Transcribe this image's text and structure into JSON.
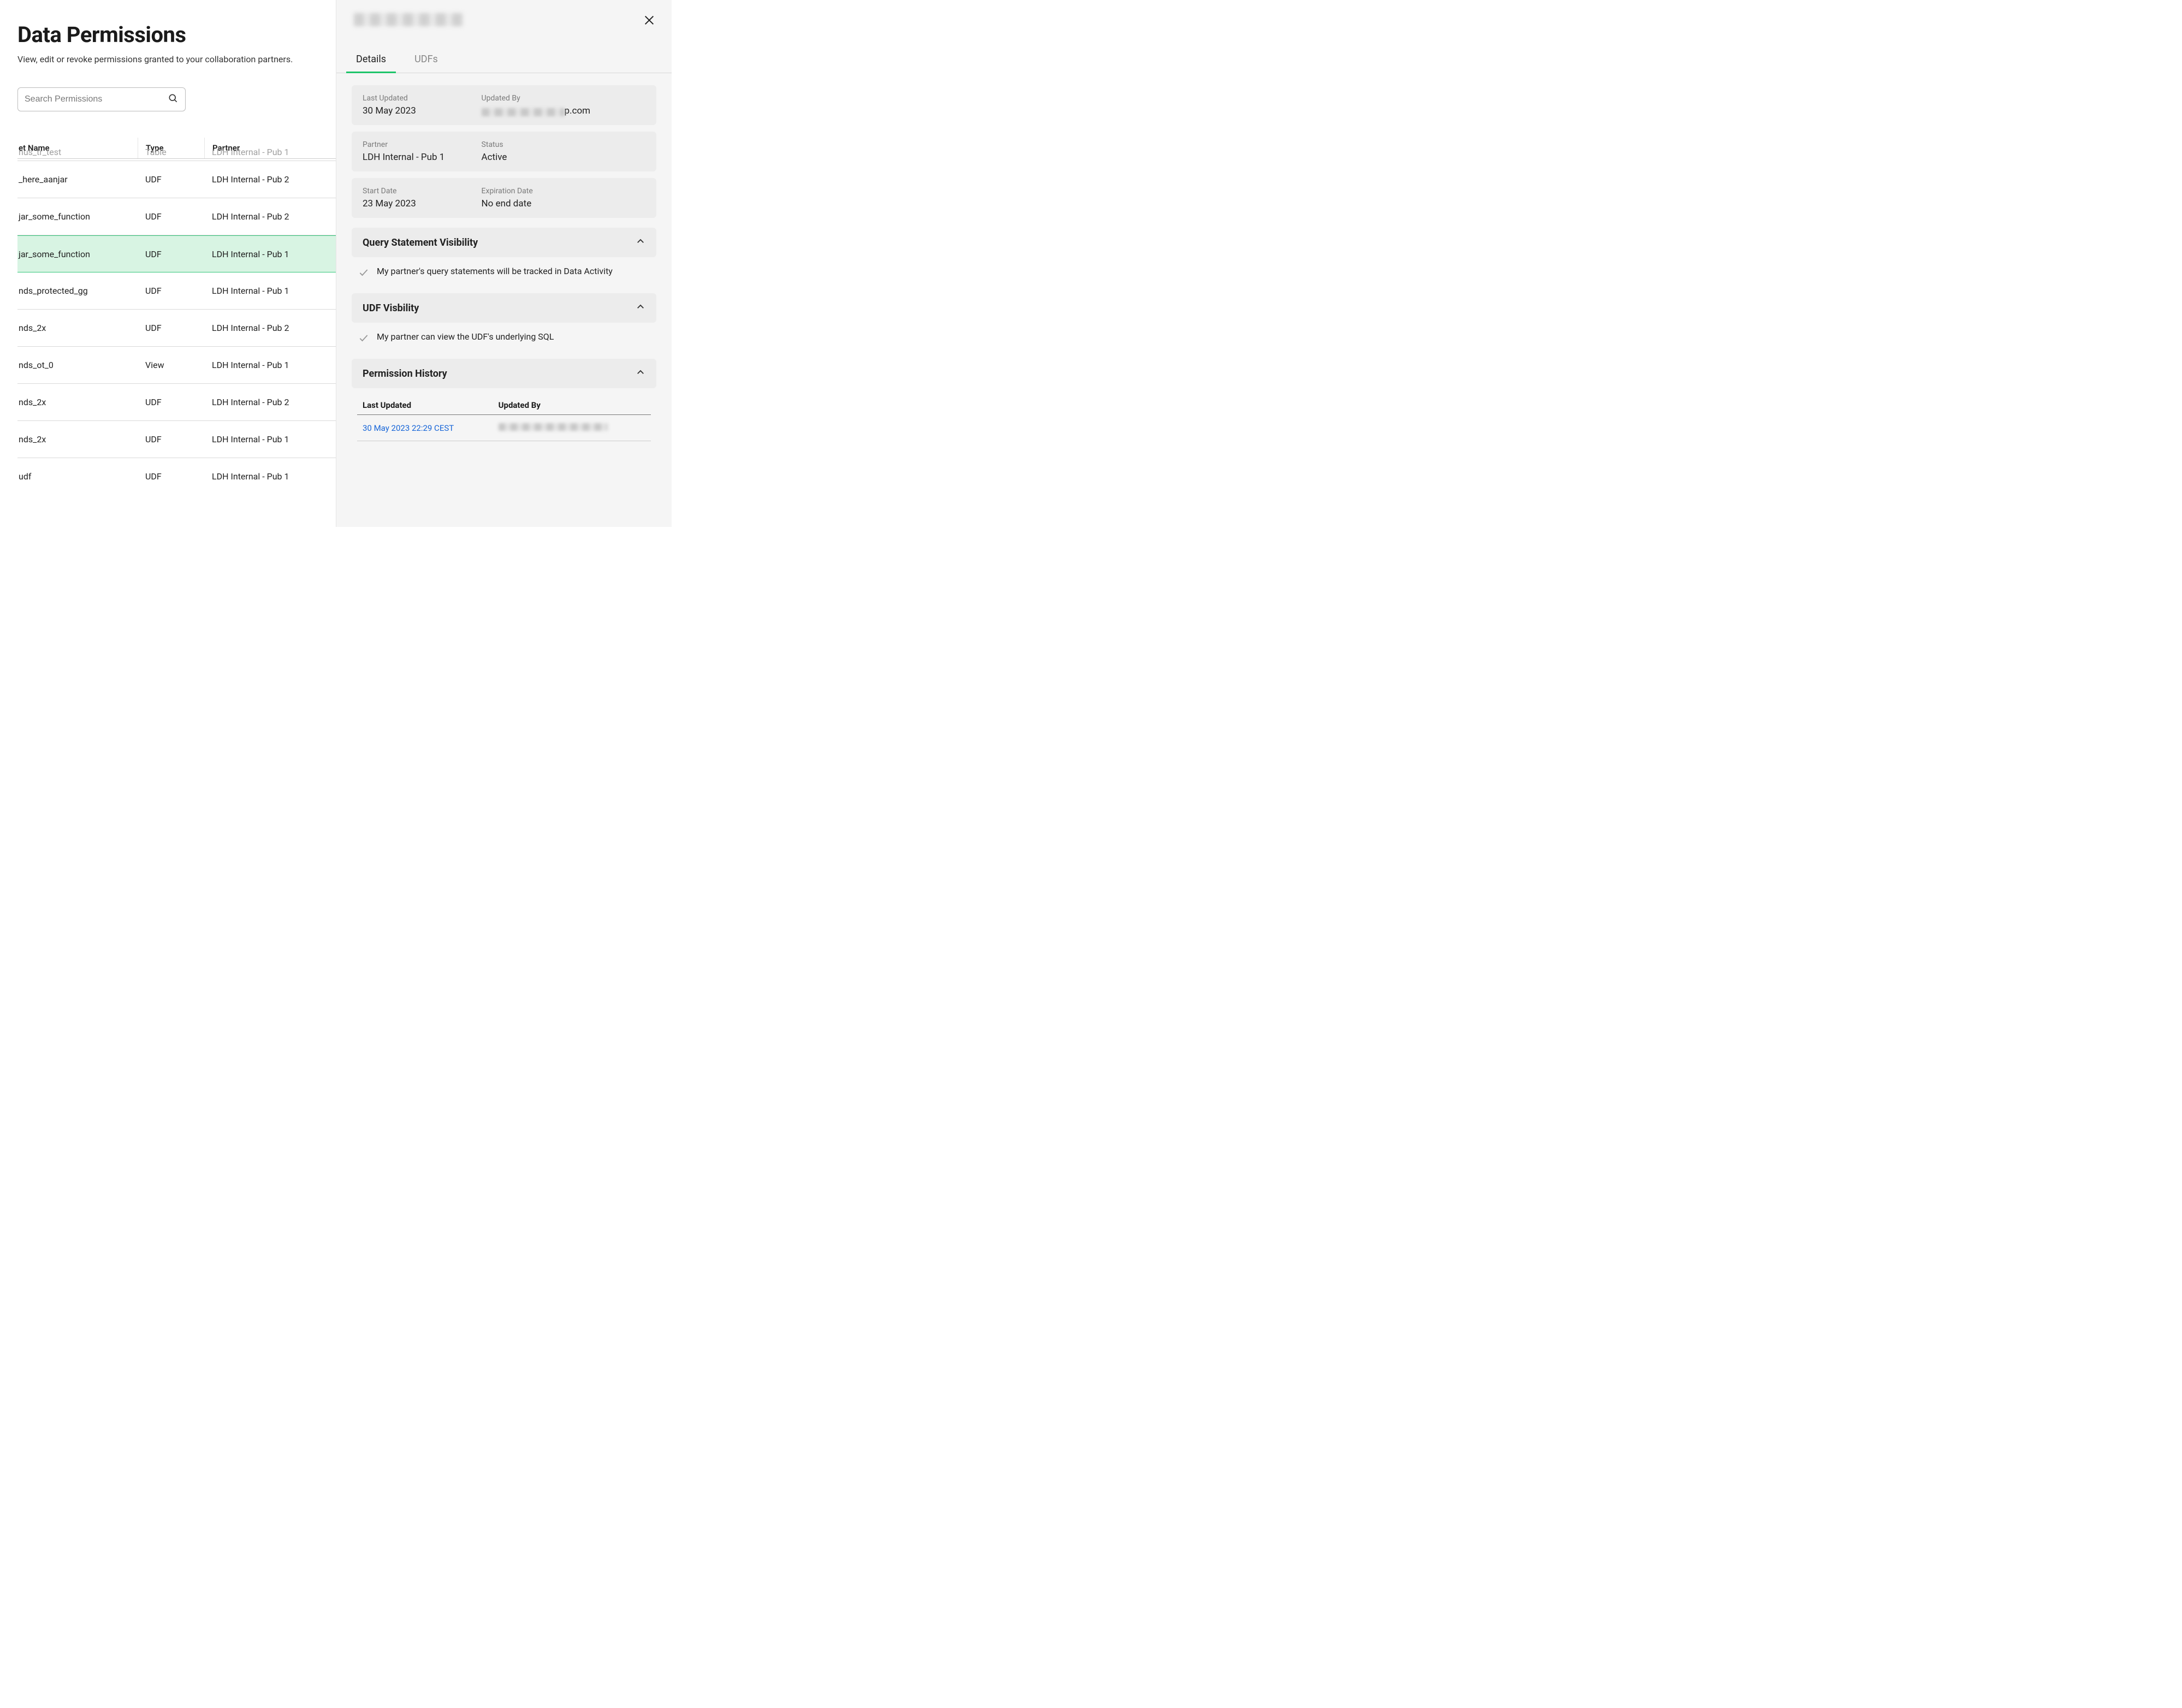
{
  "page": {
    "title": "Data Permissions",
    "subtitle": "View, edit or revoke permissions granted to your collaboration partners."
  },
  "search": {
    "placeholder": "Search Permissions",
    "value": ""
  },
  "table": {
    "headers": {
      "name": "et Name",
      "type": "Type",
      "partner": "Partner"
    },
    "rows": [
      {
        "name": "nus_tr_test",
        "type": "Table",
        "partner": "LDH Internal - Pub 1",
        "partial": true
      },
      {
        "name": "_here_aanjar",
        "type": "UDF",
        "partner": "LDH Internal - Pub 2"
      },
      {
        "name": "jar_some_function",
        "type": "UDF",
        "partner": "LDH Internal - Pub 2"
      },
      {
        "name": "jar_some_function",
        "type": "UDF",
        "partner": "LDH Internal - Pub 1",
        "selected": true
      },
      {
        "name": "nds_protected_gg",
        "type": "UDF",
        "partner": "LDH Internal - Pub 1"
      },
      {
        "name": "nds_2x",
        "type": "UDF",
        "partner": "LDH Internal - Pub 2"
      },
      {
        "name": "nds_ot_0",
        "type": "View",
        "partner": "LDH Internal - Pub 1"
      },
      {
        "name": "nds_2x",
        "type": "UDF",
        "partner": "LDH Internal - Pub 2"
      },
      {
        "name": "nds_2x",
        "type": "UDF",
        "partner": "LDH Internal - Pub 1"
      },
      {
        "name": "udf",
        "type": "UDF",
        "partner": "LDH Internal - Pub 1"
      }
    ]
  },
  "detail": {
    "tabs": {
      "details": "Details",
      "udfs": "UDFs"
    },
    "info": {
      "last_updated_label": "Last Updated",
      "last_updated_value": "30 May 2023",
      "updated_by_label": "Updated By",
      "updated_by_suffix": "p.com",
      "partner_label": "Partner",
      "partner_value": "LDH Internal - Pub 1",
      "status_label": "Status",
      "status_value": "Active",
      "start_label": "Start Date",
      "start_value": "23 May 2023",
      "expiration_label": "Expiration Date",
      "expiration_value": "No end date"
    },
    "sections": {
      "qsv": {
        "title": "Query Statement Visibility",
        "text": "My partner's query statements will be tracked in Data Activity"
      },
      "udf_vis": {
        "title": "UDF Visbility",
        "text": "My partner can view the UDF's underlying SQL"
      },
      "history": {
        "title": "Permission History",
        "col1": "Last Updated",
        "col2": "Updated By",
        "row_ts": "30 May 2023 22:29 CEST"
      }
    }
  }
}
